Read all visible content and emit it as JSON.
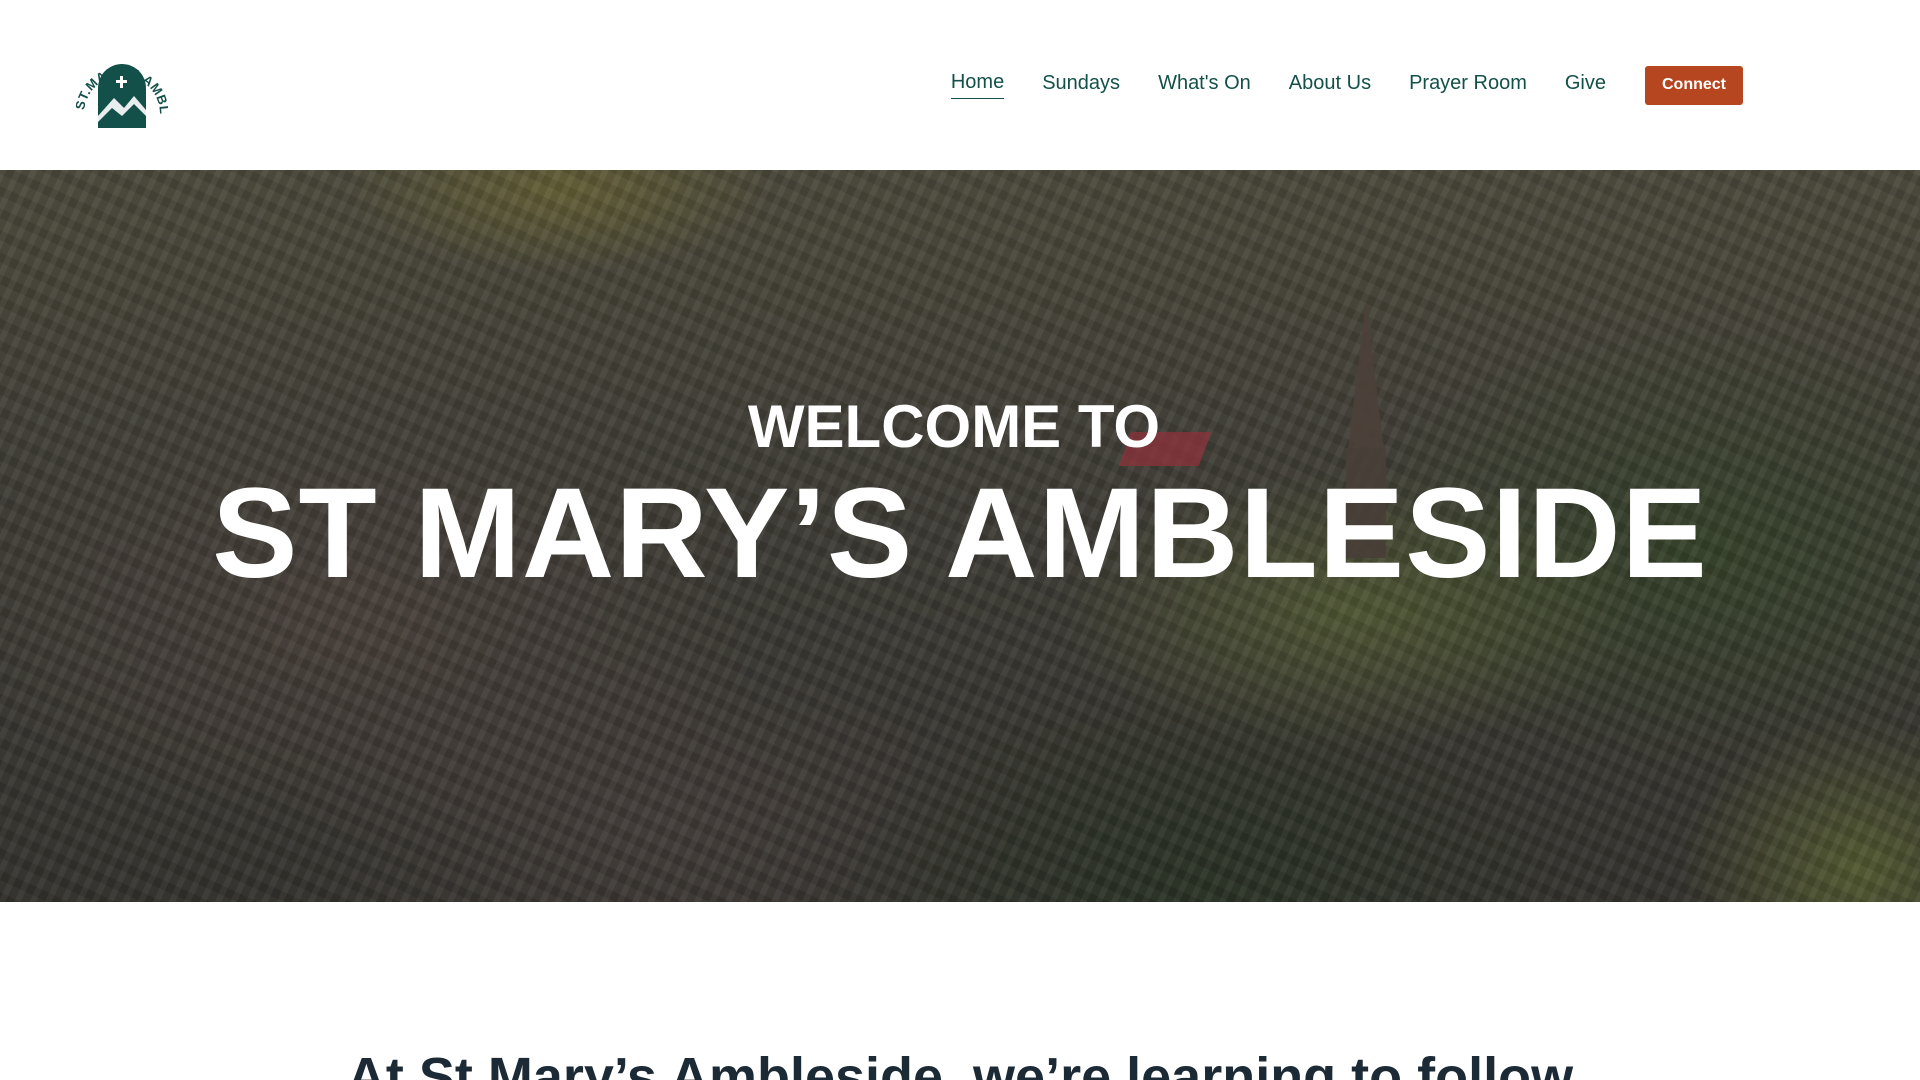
{
  "header": {
    "logo_text": "ST.MARY'S AMBLESIDE",
    "nav": [
      {
        "label": "Home",
        "active": true
      },
      {
        "label": "Sundays",
        "active": false
      },
      {
        "label": "What's On",
        "active": false
      },
      {
        "label": "About Us",
        "active": false
      },
      {
        "label": "Prayer Room",
        "active": false
      },
      {
        "label": "Give",
        "active": false
      }
    ],
    "connect_label": "Connect"
  },
  "hero": {
    "kicker": "WELCOME TO",
    "title": "ST MARY’S AMBLESIDE"
  },
  "intro": {
    "heading": "At St Mary’s Ambleside, we’re learning to follow"
  },
  "colors": {
    "brand_green": "#14504a",
    "accent_orange": "#b5461f",
    "heading_dark": "#1c2a35"
  },
  "icons": {
    "logo": "church-arch-mountain-logo"
  }
}
